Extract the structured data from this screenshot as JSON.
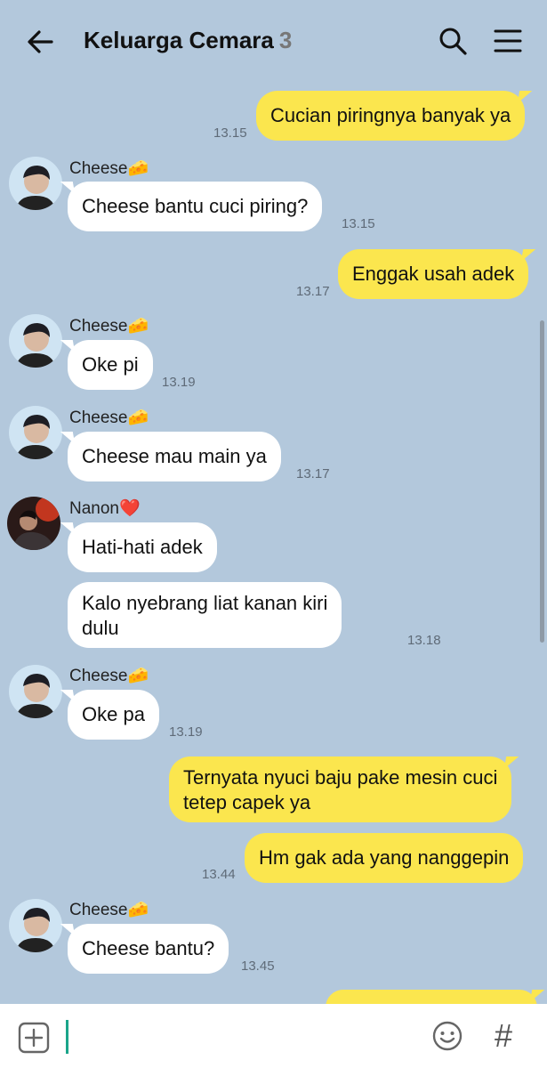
{
  "header": {
    "title": "Keluarga Cemara",
    "member_count": "3",
    "back_icon": "arrow-left-icon",
    "search_icon": "search-icon",
    "menu_icon": "hamburger-menu-icon"
  },
  "colors": {
    "background": "#b3c8dc",
    "outgoing_bubble": "#fbe64e",
    "incoming_bubble": "#ffffff",
    "cursor": "#1aa58a"
  },
  "messages": [
    {
      "text": "Cucian piringnya banyak ya",
      "time": "13.15"
    },
    {
      "sender": "Cheese🧀",
      "text": "Cheese bantu cuci piring?",
      "time": "13.15"
    },
    {
      "text": "Enggak usah adek",
      "time": "13.17"
    },
    {
      "sender": "Cheese🧀",
      "text": "Oke pi",
      "time": "13.19"
    },
    {
      "sender": "Cheese🧀",
      "text": "Cheese mau main ya",
      "time": "13.17"
    },
    {
      "sender": "Nanon❤️",
      "text": "Hati-hati adek"
    },
    {
      "text_line1": "Kalo nyebrang liat kanan kiri",
      "text_line2": "dulu",
      "time": "13.18"
    },
    {
      "sender": "Cheese🧀",
      "text": "Oke pa",
      "time": "13.19"
    },
    {
      "text_line1": "Ternyata nyuci baju pake mesin cuci",
      "text_line2": "tetep capek ya"
    },
    {
      "text": "Hm gak ada yang nanggepin",
      "time": "13.44"
    },
    {
      "sender": "Cheese🧀",
      "text": "Cheese bantu?",
      "time": "13.45"
    }
  ],
  "input_bar": {
    "plus_icon": "plus-square-icon",
    "emoji_icon": "smiley-icon",
    "hashtag_label": "#"
  }
}
